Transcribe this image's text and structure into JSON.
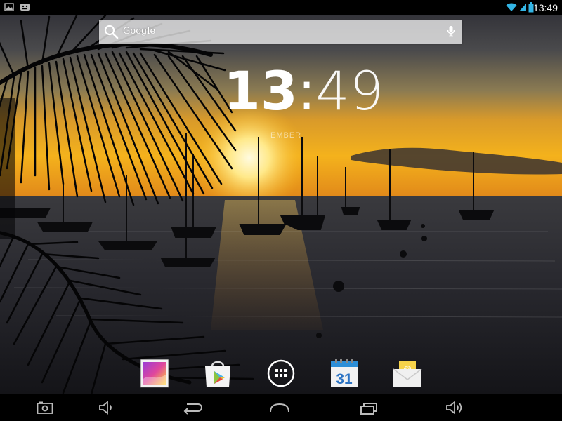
{
  "status_bar": {
    "time": "13:49",
    "left_icons": [
      "image-notification-icon",
      "android-notification-icon"
    ],
    "right_icons": [
      "wifi-icon",
      "signal-icon",
      "battery-icon"
    ]
  },
  "search": {
    "brand": "Google",
    "icons": [
      "search-icon",
      "microphone-icon"
    ]
  },
  "clock_widget": {
    "hours": "13",
    "separator": ":",
    "minutes": "49",
    "date_text": "EMBER"
  },
  "dock": {
    "apps": [
      "gallery-app-icon",
      "play-store-app-icon",
      "all-apps-icon",
      "calendar-app-icon",
      "email-app-icon"
    ],
    "calendar_day": "31",
    "email_symbol": "@"
  },
  "nav_bar": {
    "buttons": [
      "screenshot-icon",
      "volume-down-icon",
      "back-icon",
      "home-icon",
      "recent-apps-icon",
      "volume-up-icon"
    ]
  }
}
